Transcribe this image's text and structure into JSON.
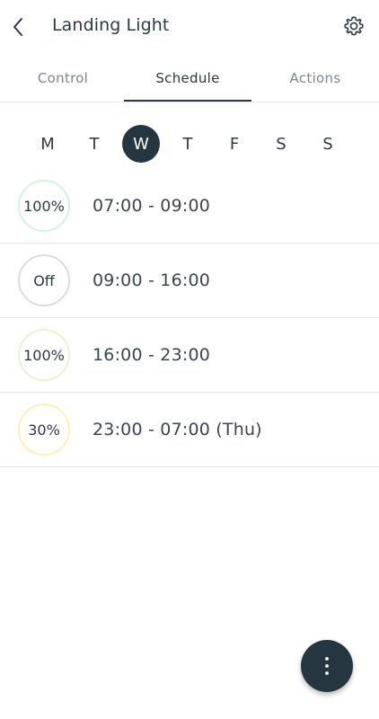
{
  "header": {
    "title": "Landing Light",
    "back_icon": "chevron-left-icon",
    "settings_icon": "gear-icon"
  },
  "tabs": [
    {
      "label": "Control",
      "active": false
    },
    {
      "label": "Schedule",
      "active": true
    },
    {
      "label": "Actions",
      "active": false
    }
  ],
  "days": [
    {
      "label": "M",
      "selected": false
    },
    {
      "label": "T",
      "selected": false
    },
    {
      "label": "W",
      "selected": true
    },
    {
      "label": "T",
      "selected": false
    },
    {
      "label": "F",
      "selected": false
    },
    {
      "label": "S",
      "selected": false
    },
    {
      "label": "S",
      "selected": false
    }
  ],
  "schedule": [
    {
      "level": "100%",
      "time": "07:00 - 09:00",
      "ring_color": "#d7f0df"
    },
    {
      "level": "Off",
      "time": "09:00 - 16:00",
      "ring_color": "#dcdcdc"
    },
    {
      "level": "100%",
      "time": "16:00 - 23:00",
      "ring_color": "#e8f3d2"
    },
    {
      "level": "30%",
      "time": "23:00 - 07:00 (Thu)",
      "ring_color": "#fbf1b8"
    }
  ],
  "fab": {
    "icon": "more-vertical-icon"
  },
  "colors": {
    "accent_dark": "#263640",
    "text": "#2b3a42",
    "tab_inactive": "#7a878d",
    "divider": "#e6e6e6"
  }
}
